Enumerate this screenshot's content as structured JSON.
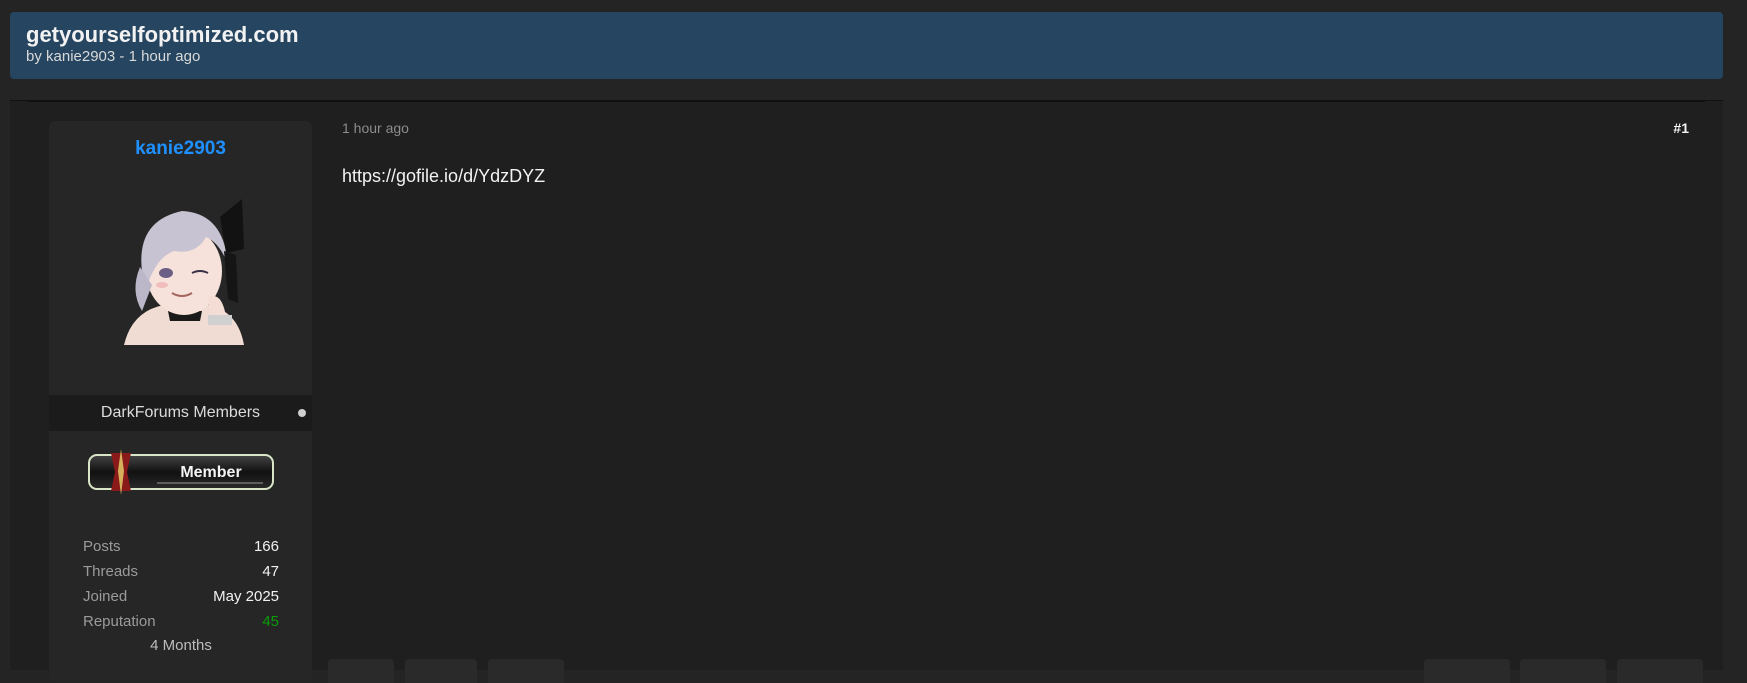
{
  "thread": {
    "title": "getyourselfoptimized.com",
    "meta": "by kanie2903 - 1 hour ago"
  },
  "post": {
    "date": "1 hour ago",
    "number": "#1",
    "body": "https://gofile.io/d/YdzDYZ"
  },
  "author": {
    "username": "kanie2903",
    "group": "DarkForums Members",
    "rank_label": "Member",
    "stats": [
      {
        "label": "Posts",
        "value": "166"
      },
      {
        "label": "Threads",
        "value": "47"
      },
      {
        "label": "Joined",
        "value": "May 2025"
      },
      {
        "label": "Reputation",
        "value": "45"
      }
    ],
    "duration": "4 Months"
  },
  "colors": {
    "header_bg": "#254560",
    "username": "#1e90ff",
    "reputation": "#0a9d0a"
  }
}
